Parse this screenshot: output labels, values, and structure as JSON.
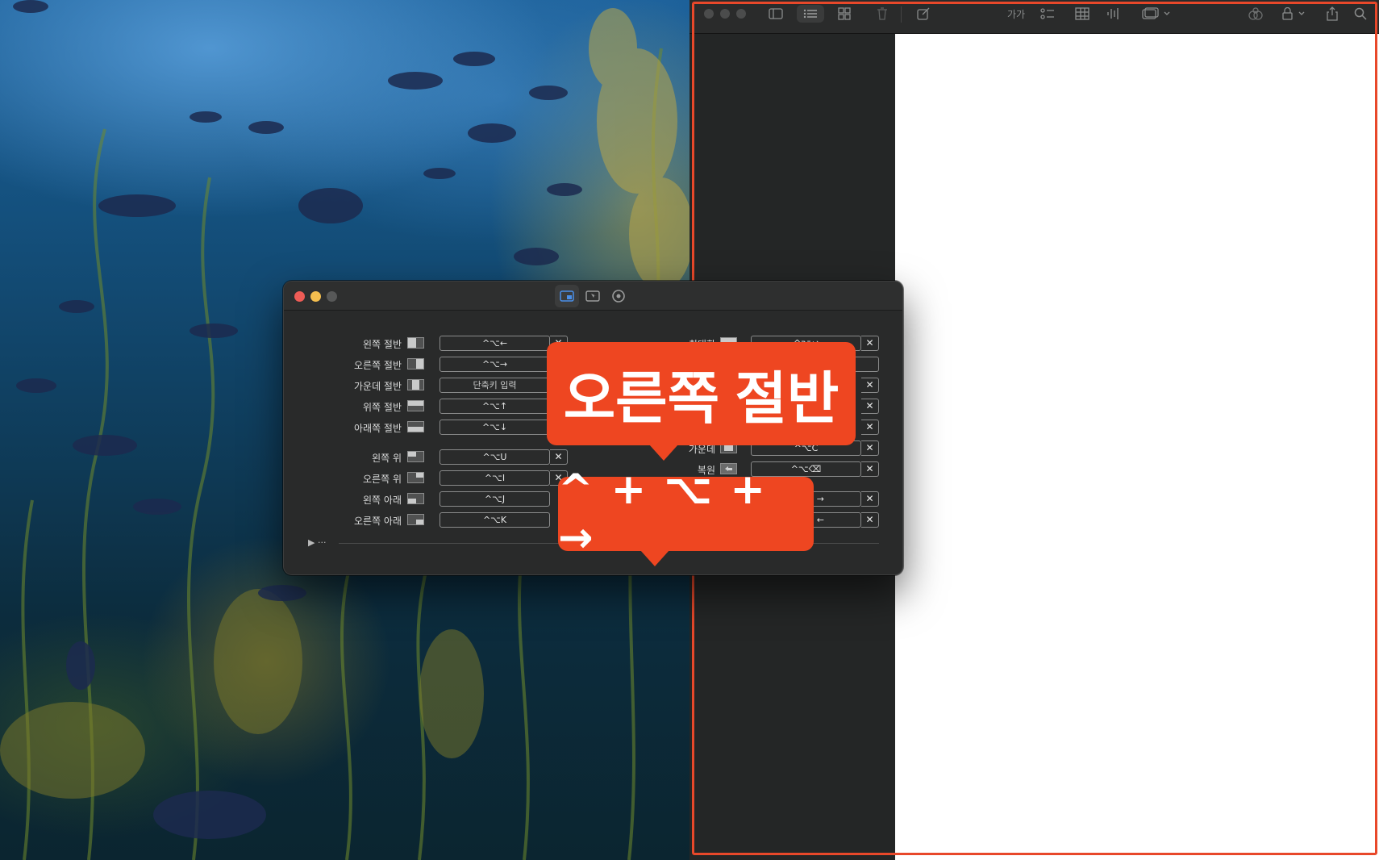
{
  "wallpaper": {
    "scene": "underwater-kelp-forest"
  },
  "notes_window": {
    "toolbar_icons": [
      "sidebar-icon",
      "list-view-icon",
      "grid-view-icon",
      "trash-icon",
      "compose-icon",
      "format-text-icon",
      "checklist-icon",
      "table-icon",
      "audio-icon",
      "media-icon",
      "collaborate-icon",
      "lock-icon",
      "share-icon",
      "search-icon"
    ],
    "format_label": "가가",
    "highlight_color": "#e8482a"
  },
  "preferences": {
    "tabs": [
      "window-layout-icon",
      "snap-areas-icon",
      "settings-gear-icon"
    ],
    "left_column": [
      {
        "label": "왼쪽 절반",
        "shortcut": "^⌥←",
        "icon": "left-half"
      },
      {
        "label": "오른쪽 절반",
        "shortcut": "^⌥→",
        "icon": "right-half"
      },
      {
        "label": "가운데 절반",
        "shortcut": "단축키 입력",
        "icon": "center-half"
      },
      {
        "label": "위쪽 절반",
        "shortcut": "^⌥↑",
        "icon": "top-half"
      },
      {
        "label": "아래쪽 절반",
        "shortcut": "^⌥↓",
        "icon": "bottom-half"
      },
      {
        "label": "왼쪽 위",
        "shortcut": "^⌥U",
        "icon": "top-left"
      },
      {
        "label": "오른쪽 위",
        "shortcut": "^⌥I",
        "icon": "top-right"
      },
      {
        "label": "왼쪽 아래",
        "shortcut": "^⌥J",
        "icon": "bottom-left"
      },
      {
        "label": "오른쪽 아래",
        "shortcut": "^⌥K",
        "icon": "bottom-right"
      }
    ],
    "right_column": [
      {
        "label": "최대화",
        "shortcut": "^⌥↩",
        "icon": "maximize"
      },
      {
        "label": "",
        "shortcut": "",
        "icon": ""
      },
      {
        "label": "",
        "shortcut": "",
        "icon": ""
      },
      {
        "label": "",
        "shortcut": "",
        "icon": ""
      },
      {
        "label": "",
        "shortcut": "",
        "icon": ""
      },
      {
        "label": "가운데",
        "shortcut": "^⌥C",
        "icon": "center"
      },
      {
        "label": "복원",
        "shortcut": "^⌥⌫",
        "icon": "restore"
      },
      {
        "label": "",
        "shortcut": "→",
        "icon": ""
      },
      {
        "label": "",
        "shortcut": "←",
        "icon": ""
      }
    ],
    "clear_label": "✕",
    "expander_label": "▶ ···"
  },
  "overlays": {
    "action_name": "오른쪽 절반",
    "key_combo": "^ + ⌥ + →",
    "accent": "#ee4621"
  }
}
